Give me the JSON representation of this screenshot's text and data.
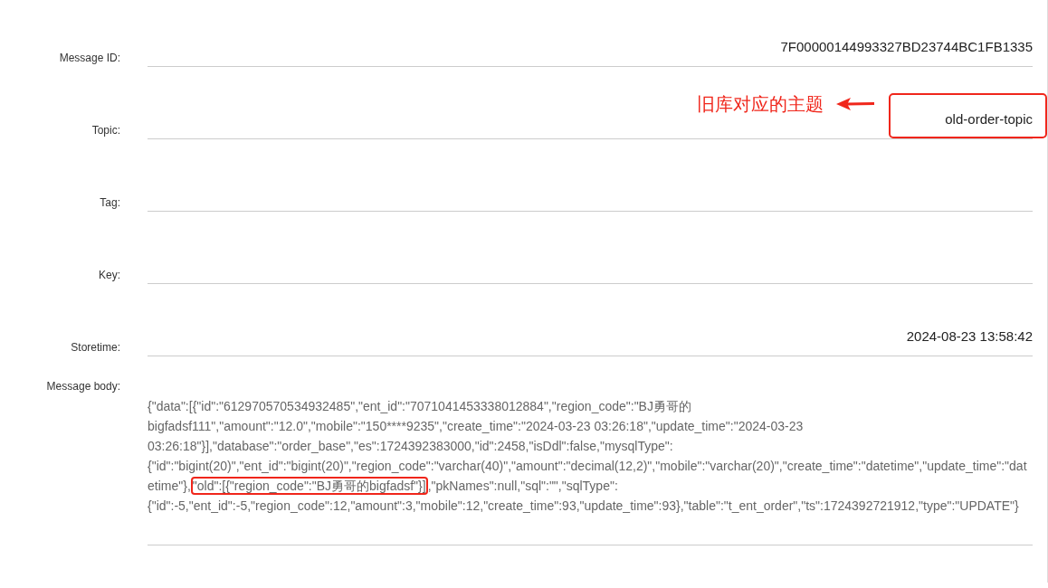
{
  "fields": [
    {
      "label": "Message ID:",
      "value": "7F00000144993327BD23744BC1FB1335",
      "boxed": false
    },
    {
      "label": "Topic:",
      "value": "old-order-topic",
      "boxed": true,
      "note": "旧库对应的主题"
    },
    {
      "label": "Tag:"
    },
    {
      "label": "Key:"
    },
    {
      "label": "Storetime:",
      "value": "2024-08-23 13:58:42",
      "boxed": false
    }
  ],
  "message_body": {
    "label": "Message body:",
    "segments": [
      {
        "text": "{\"data\":[{\"id\":\"612970570534932485\",\"ent_id\":\"7071041453338012884\",\"region_code\":\"BJ勇哥的bigfadsf111\",\"amount\":\"12.0\",\"mobile\":\"150****9235\",\"create_time\":\"2024-03-23 03:26:18\",\"update_time\":\"2024-03-23 03:26:18\"}],\"database\":\"order_base\",\"es\":1724392383000,\"id\":2458,\"isDdl\":false,\"mysqlType\":{\"id\":\"bigint(20)\",\"ent_id\":\"bigint(20)\",\"region_code\":\"varchar(40)\",\"amount\":\"decimal(12,2)\",\"mobile\":\"varchar(20)\",\"create_time\":\"datetime\",\"update_time\":\"datetime\"},",
        "boxed": false
      },
      {
        "text": "\"old\":[{\"region_code\":\"BJ勇哥的bigfadsf\"}]",
        "boxed": true
      },
      {
        "text": ",\"pkNames\":null,\"sql\":\"\",\"sqlType\":{\"id\":-5,\"ent_id\":-5,\"region_code\":12,\"amount\":3,\"mobile\":12,\"create_time\":93,\"update_time\":93},\"table\":\"t_ent_order\",\"ts\":1724392721912,\"type\":\"UPDATE\"}",
        "boxed": false
      }
    ]
  }
}
